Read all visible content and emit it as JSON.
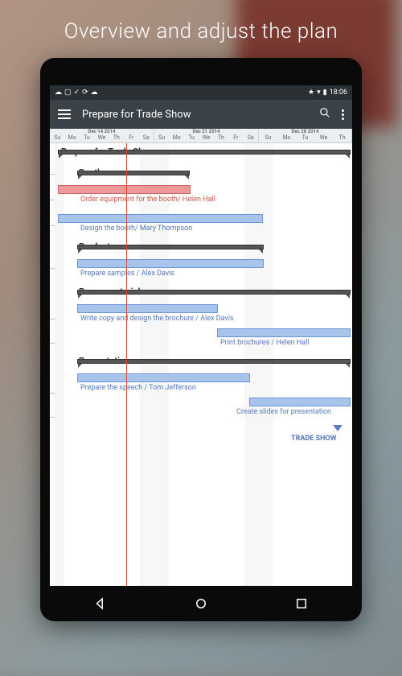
{
  "heading": "Overview and adjust the plan",
  "status": {
    "time": "18:06"
  },
  "appbar": {
    "title": "Prepare for Trade Show"
  },
  "weeks": [
    {
      "label": "Dec 14 2014",
      "days": [
        "Su",
        "Mo",
        "Tu",
        "We",
        "Th",
        "Fr",
        "Sa"
      ],
      "offset": -5
    },
    {
      "label": "Dec 21 2014",
      "days": [
        "Su",
        "Mo",
        "Tu",
        "We",
        "Th",
        "Fr",
        "Sa"
      ],
      "offset": 160
    },
    {
      "label": "Dec 28 2014",
      "days": [
        "Su",
        "Mo",
        "Tu",
        "We",
        "Th",
        "Fr",
        "Sa"
      ],
      "offset": 320
    }
  ],
  "project": {
    "title": "Prepare for Trade Show",
    "groups": [
      {
        "name": "Booth",
        "tasks": [
          {
            "label": "Order equipment for the booth/ Helen Hall",
            "color": "red"
          },
          {
            "label": "Design the booth/ Mary Thompson",
            "color": "blue"
          }
        ]
      },
      {
        "name": "Product",
        "tasks": [
          {
            "label": "Prepare samples / Alex Davis",
            "color": "blue"
          }
        ]
      },
      {
        "name": "Promo materials",
        "tasks": [
          {
            "label": "Write copy and design the brochure / Alex Davis",
            "color": "blue"
          },
          {
            "label": "Print brochures / Helen Hall",
            "color": "blue"
          }
        ]
      },
      {
        "name": "Presentation",
        "tasks": [
          {
            "label": "Prepare the speech / Tom Jefferson",
            "color": "blue"
          },
          {
            "label": "Create slides for presentation",
            "color": "blue"
          }
        ]
      }
    ],
    "milestone": "TRADE SHOW"
  },
  "chart_data": {
    "type": "gantt",
    "x_unit": "day",
    "x_range": [
      "2014-12-13",
      "2015-01-02"
    ],
    "today_line": "2014-12-17",
    "rows": [
      {
        "name": "Prepare for Trade Show",
        "kind": "summary",
        "start": "2014-12-13",
        "end": "2015-01-01"
      },
      {
        "name": "Booth",
        "kind": "summary",
        "start": "2014-12-13",
        "end": "2014-12-22"
      },
      {
        "name": "Order equipment for the booth/ Helen Hall",
        "kind": "task",
        "start": "2014-12-13",
        "end": "2014-12-22",
        "color": "red"
      },
      {
        "name": "Design the booth/ Mary Thompson",
        "kind": "task",
        "start": "2014-12-13",
        "end": "2014-12-27",
        "color": "blue"
      },
      {
        "name": "Product",
        "kind": "summary",
        "start": "2014-12-15",
        "end": "2014-12-27"
      },
      {
        "name": "Prepare samples / Alex Davis",
        "kind": "task",
        "start": "2014-12-15",
        "end": "2014-12-27",
        "color": "blue"
      },
      {
        "name": "Promo materials",
        "kind": "summary",
        "start": "2014-12-15",
        "end": "2015-01-01"
      },
      {
        "name": "Write copy and design the brochure / Alex Davis",
        "kind": "task",
        "start": "2014-12-15",
        "end": "2014-12-24",
        "color": "blue"
      },
      {
        "name": "Print brochures / Helen Hall",
        "kind": "task",
        "start": "2014-12-24",
        "end": "2015-01-01",
        "color": "blue"
      },
      {
        "name": "Presentation",
        "kind": "summary",
        "start": "2014-12-15",
        "end": "2015-01-01"
      },
      {
        "name": "Prepare the speech / Tom Jefferson",
        "kind": "task",
        "start": "2014-12-15",
        "end": "2014-12-26",
        "color": "blue"
      },
      {
        "name": "Create slides for presentation",
        "kind": "task",
        "start": "2014-12-26",
        "end": "2015-01-01",
        "color": "blue"
      },
      {
        "name": "TRADE SHOW",
        "kind": "milestone",
        "date": "2015-01-01"
      }
    ]
  }
}
